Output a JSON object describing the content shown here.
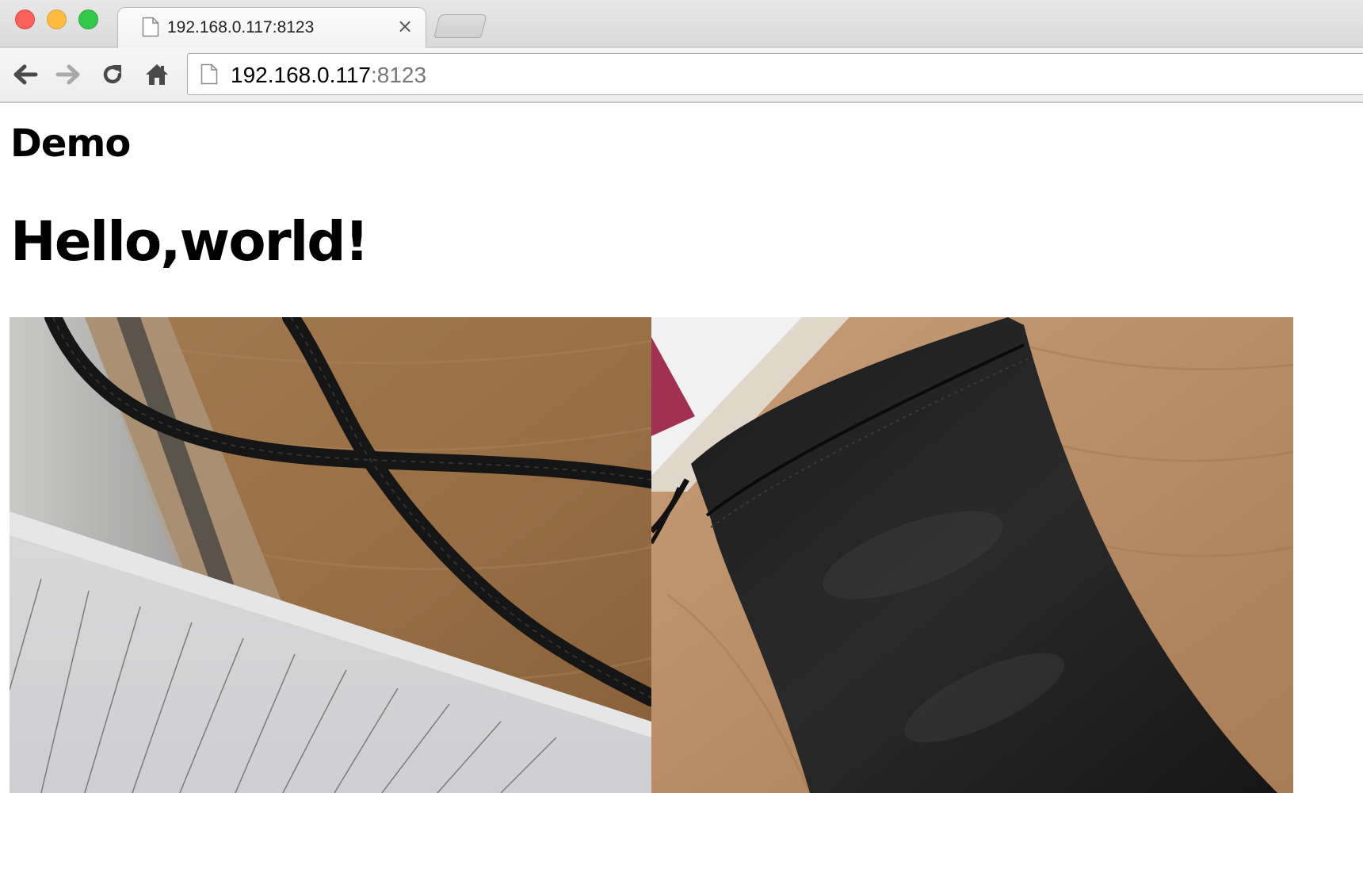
{
  "browser": {
    "tab": {
      "title": "192.168.0.117:8123",
      "close_glyph": "×"
    },
    "address_bar": {
      "host": "192.168.0.117",
      "port": ":8123"
    },
    "icons": {
      "back": "back-arrow-icon",
      "forward": "forward-arrow-icon",
      "reload": "reload-icon",
      "home": "home-icon",
      "page": "page-icon"
    },
    "colors": {
      "close": "#fc605b",
      "minimize": "#fdbc40",
      "zoom": "#34c84a"
    }
  },
  "page": {
    "site_title": "Demo",
    "heading": "Hello,world!"
  }
}
